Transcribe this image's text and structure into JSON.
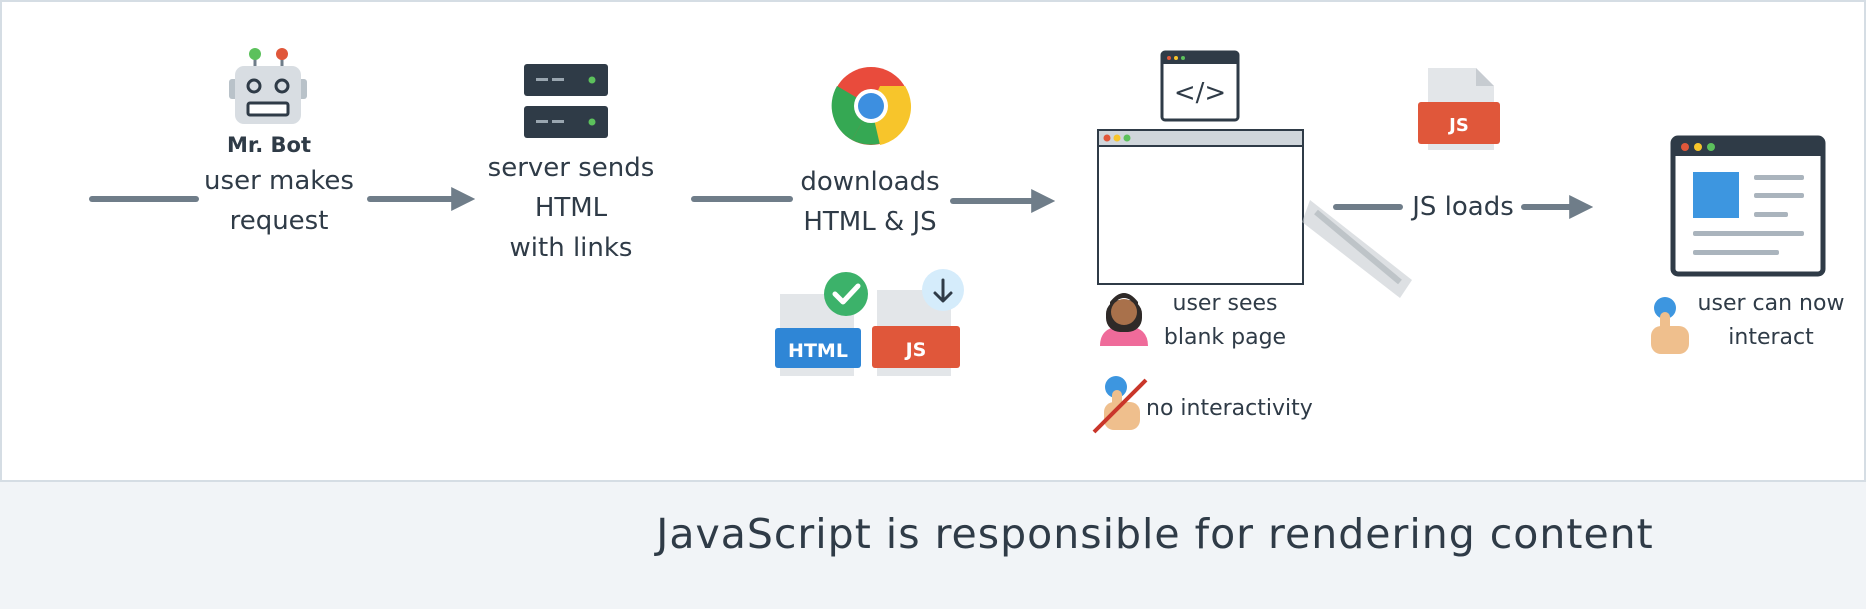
{
  "steps": {
    "bot": {
      "name": "Mr. Bot",
      "line1": "user makes",
      "line2": "request"
    },
    "server": {
      "line1": "server sends",
      "line2": "HTML",
      "line3": "with links"
    },
    "browser": {
      "line1": "downloads",
      "line2": "HTML & JS"
    },
    "blank": {
      "line1": "user sees",
      "line2": "blank page",
      "no_interactivity": "no interactivity"
    },
    "js": {
      "label": "JS loads"
    },
    "final": {
      "line1": "user can now",
      "line2": "interact"
    }
  },
  "file_badges": {
    "html": "HTML",
    "js": "JS"
  },
  "code_icon_text": "</>",
  "caption": "JavaScript is responsible for rendering content",
  "colors": {
    "arrow": "#6f7d89",
    "html_badge": "#2f86d6",
    "js_badge": "#e0573a",
    "check": "#3cb26a",
    "accent_blue": "#3d96e0",
    "dark": "#2f3b47"
  }
}
